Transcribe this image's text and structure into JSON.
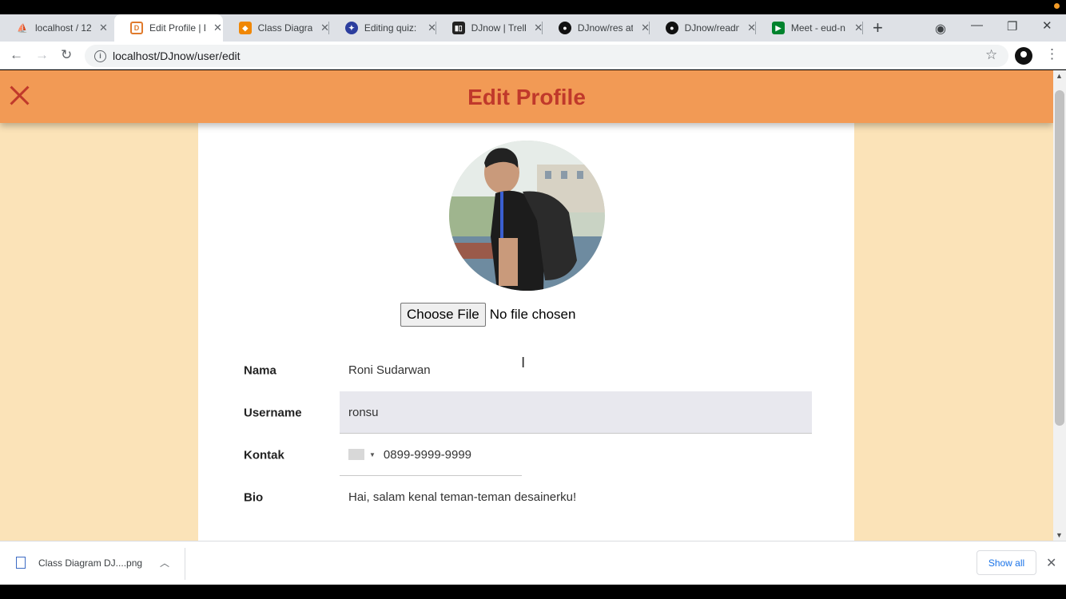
{
  "browser": {
    "tabs": [
      {
        "title": "localhost / 12",
        "icon": "phpmyadmin-icon",
        "active": false
      },
      {
        "title": "Edit Profile | D",
        "icon": "djnow-favicon-icon",
        "active": true
      },
      {
        "title": "Class Diagram",
        "icon": "drawio-icon",
        "active": false
      },
      {
        "title": "Editing quiz:",
        "icon": "quiz-icon",
        "active": false
      },
      {
        "title": "DJnow | Trello",
        "icon": "trello-icon",
        "active": false
      },
      {
        "title": "DJnow/res at",
        "icon": "github-icon",
        "active": false
      },
      {
        "title": "DJnow/readm",
        "icon": "github-icon",
        "active": false
      },
      {
        "title": "Meet - eud-n",
        "icon": "google-meet-icon",
        "active": false
      }
    ],
    "new_tab": "+",
    "url": "localhost/DJnow/user/edit"
  },
  "app": {
    "header_title": "Edit Profile",
    "accent_color": "#f29a55",
    "title_color": "#c0392b",
    "page_bg": "#fbe3b8"
  },
  "form": {
    "file_button": "Choose File",
    "file_status": "No file chosen",
    "fields": {
      "nama": {
        "label": "Nama",
        "value": "Roni Sudarwan"
      },
      "username": {
        "label": "Username",
        "value": "ronsu"
      },
      "kontak": {
        "label": "Kontak",
        "value": "0899-9999-9999"
      },
      "bio": {
        "label": "Bio",
        "value": "Hai, salam kenal teman-teman desainerku!"
      }
    }
  },
  "downloads": {
    "file_name": "Class Diagram DJ....png",
    "show_all": "Show all"
  }
}
